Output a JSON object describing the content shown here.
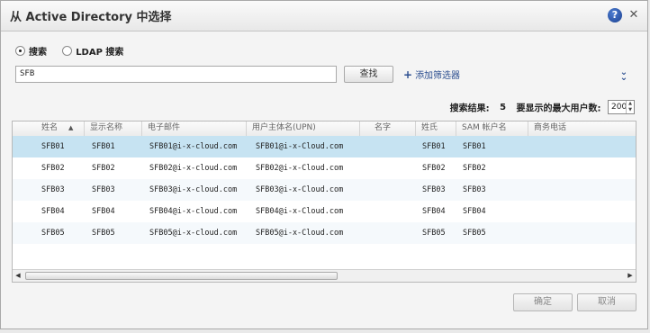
{
  "dialog": {
    "title": "从 Active Directory 中选择"
  },
  "search_mode": {
    "options": [
      {
        "label": "搜索",
        "checked": true
      },
      {
        "label": "LDAP 搜索",
        "checked": false
      }
    ]
  },
  "search": {
    "value": "SFB",
    "find_label": "查找",
    "add_filter_label": "添加筛选器"
  },
  "results": {
    "label": "搜索结果:",
    "count": "5",
    "max_label": "要显示的最大用户数:",
    "max_value": "200"
  },
  "table": {
    "columns": [
      "姓名",
      "显示名称",
      "电子邮件",
      "用户主体名(UPN)",
      "名字",
      "姓氏",
      "SAM 帐户名",
      "商务电话"
    ],
    "rows": [
      [
        "SFB01",
        "SFB01",
        "SFB01@i-x-cloud.com",
        "SFB01@i-x-Cloud.com",
        "",
        "SFB01",
        "SFB01",
        ""
      ],
      [
        "SFB02",
        "SFB02",
        "SFB02@i-x-cloud.com",
        "SFB02@i-x-Cloud.com",
        "",
        "SFB02",
        "SFB02",
        ""
      ],
      [
        "SFB03",
        "SFB03",
        "SFB03@i-x-cloud.com",
        "SFB03@i-x-Cloud.com",
        "",
        "SFB03",
        "SFB03",
        ""
      ],
      [
        "SFB04",
        "SFB04",
        "SFB04@i-x-cloud.com",
        "SFB04@i-x-Cloud.com",
        "",
        "SFB04",
        "SFB04",
        ""
      ],
      [
        "SFB05",
        "SFB05",
        "SFB05@i-x-cloud.com",
        "SFB05@i-x-Cloud.com",
        "",
        "SFB05",
        "SFB05",
        ""
      ]
    ],
    "selected_row": 0
  },
  "footer": {
    "ok_label": "确定",
    "cancel_label": "取消"
  },
  "icons": {
    "help": "help-icon",
    "close": "close-icon",
    "sort": "sort-ascending-icon",
    "expand": "double-chevron-down-icon"
  },
  "colors": {
    "selected_row": "#c6e3f2",
    "link": "#2a4d8f"
  }
}
